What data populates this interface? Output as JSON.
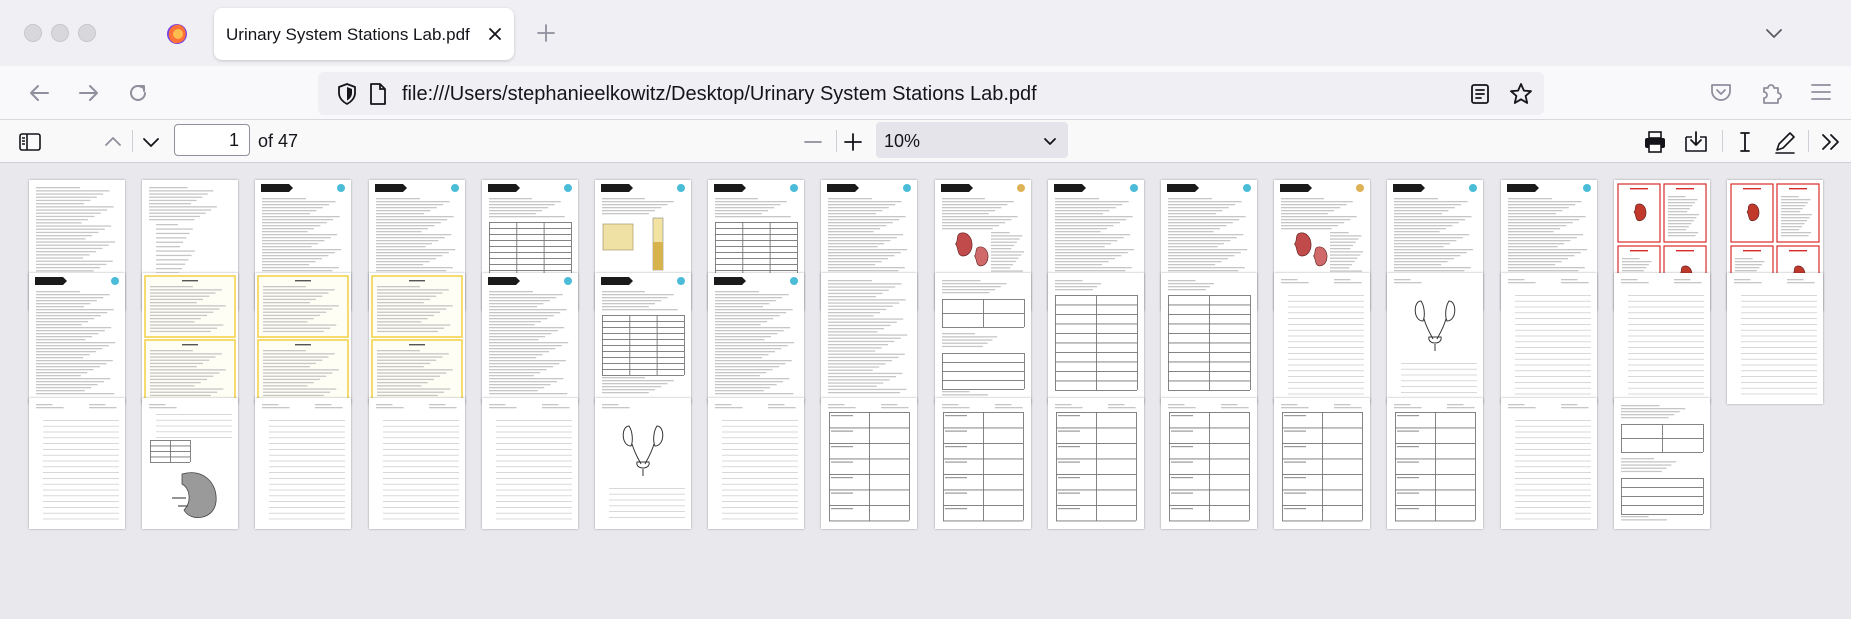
{
  "browser": {
    "tab": {
      "title": "Urinary System Stations Lab.pdf"
    },
    "url": "file:///Users/stephanieelkowitz/Desktop/Urinary System Stations Lab.pdf"
  },
  "pdf_toolbar": {
    "current_page": "1",
    "page_count_label": "of 47",
    "zoom": "10%"
  },
  "thumbnails": {
    "total": 47,
    "per_row": 16,
    "colors": {
      "page": "#ffffff",
      "text_line": "#c6c6c6",
      "header_bar": "#1a1a1a",
      "accent_red": "#d92b2b",
      "accent_yellow": "#f3d24e",
      "accent_gold": "#d8a63a",
      "accent_teal": "#2ab0d0"
    },
    "pages": [
      {
        "kind": "text"
      },
      {
        "kind": "list"
      },
      {
        "kind": "header-text"
      },
      {
        "kind": "header-text"
      },
      {
        "kind": "header-table"
      },
      {
        "kind": "header-diagram"
      },
      {
        "kind": "header-table"
      },
      {
        "kind": "header-text"
      },
      {
        "kind": "kidney-diagram"
      },
      {
        "kind": "header-text"
      },
      {
        "kind": "header-text"
      },
      {
        "kind": "kidney-diagram"
      },
      {
        "kind": "header-text"
      },
      {
        "kind": "header-text"
      },
      {
        "kind": "red-cards"
      },
      {
        "kind": "red-cards"
      },
      {
        "kind": "header-text"
      },
      {
        "kind": "yellow-cards"
      },
      {
        "kind": "yellow-cards"
      },
      {
        "kind": "yellow-cards"
      },
      {
        "kind": "header-text"
      },
      {
        "kind": "header-table"
      },
      {
        "kind": "header-text"
      },
      {
        "kind": "text"
      },
      {
        "kind": "form"
      },
      {
        "kind": "worksheet-table"
      },
      {
        "kind": "worksheet-table"
      },
      {
        "kind": "worksheet"
      },
      {
        "kind": "urinary-diagram"
      },
      {
        "kind": "worksheet"
      },
      {
        "kind": "worksheet"
      },
      {
        "kind": "worksheet"
      },
      {
        "kind": "worksheet"
      },
      {
        "kind": "kidney-worksheet"
      },
      {
        "kind": "worksheet"
      },
      {
        "kind": "worksheet"
      },
      {
        "kind": "worksheet"
      },
      {
        "kind": "urinary-diagram"
      },
      {
        "kind": "worksheet"
      },
      {
        "kind": "grid-form"
      },
      {
        "kind": "grid-form"
      },
      {
        "kind": "grid-form"
      },
      {
        "kind": "grid-form"
      },
      {
        "kind": "grid-form"
      },
      {
        "kind": "grid-form"
      },
      {
        "kind": "worksheet"
      },
      {
        "kind": "form"
      }
    ]
  }
}
